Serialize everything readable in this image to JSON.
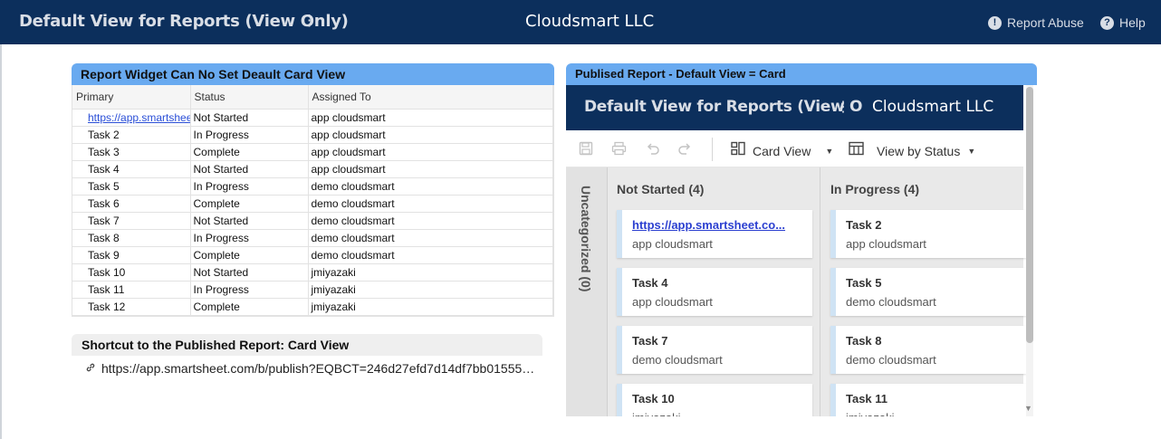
{
  "topbar": {
    "title": "Default View for Reports (View Only)",
    "brand": "Cloudsmart LLC",
    "report_abuse": "Report Abuse",
    "help": "Help"
  },
  "widget_report": {
    "title": "Report Widget Can No Set Deault Card View",
    "columns": [
      "Primary",
      "Status",
      "Assigned To"
    ],
    "rows": [
      [
        "https://app.smartsheet.com",
        "Not Started",
        "app cloudsmart"
      ],
      [
        "Task 2",
        "In Progress",
        "app cloudsmart"
      ],
      [
        "Task 3",
        "Complete",
        "app cloudsmart"
      ],
      [
        "Task 4",
        "Not Started",
        "app cloudsmart"
      ],
      [
        "Task 5",
        "In Progress",
        "demo cloudsmart"
      ],
      [
        "Task 6",
        "Complete",
        "demo cloudsmart"
      ],
      [
        "Task 7",
        "Not Started",
        "demo cloudsmart"
      ],
      [
        "Task 8",
        "In Progress",
        "demo cloudsmart"
      ],
      [
        "Task 9",
        "Complete",
        "demo cloudsmart"
      ],
      [
        "Task 10",
        "Not Started",
        "jmiyazaki"
      ],
      [
        "Task 11",
        "In Progress",
        "jmiyazaki"
      ],
      [
        "Task 12",
        "Complete",
        "jmiyazaki"
      ]
    ]
  },
  "widget_shortcut": {
    "title": "Shortcut to the Published Report: Card View",
    "link_text": "https://app.smartsheet.com/b/publish?EQBCT=246d27efd7d14df7bb01555…"
  },
  "widget_published": {
    "title": "Publised Report - Default View = Card",
    "inner_title": "Default View for Reports (View O",
    "inner_brand": "Cloudsmart LLC",
    "card_view_label": "Card View",
    "view_by_label": "View by Status",
    "uncategorized_label": "Uncategorized (0)",
    "columns": [
      {
        "header": "Not Started (4)",
        "cards": [
          {
            "title": "https://app.smartsheet.co...",
            "sub": "app cloudsmart",
            "link": true
          },
          {
            "title": "Task 4",
            "sub": "app cloudsmart"
          },
          {
            "title": "Task 7",
            "sub": "demo cloudsmart"
          },
          {
            "title": "Task 10",
            "sub": "jmiyazaki"
          }
        ]
      },
      {
        "header": "In Progress (4)",
        "cards": [
          {
            "title": "Task 2",
            "sub": "app cloudsmart"
          },
          {
            "title": "Task 5",
            "sub": "demo cloudsmart"
          },
          {
            "title": "Task 8",
            "sub": "demo cloudsmart"
          },
          {
            "title": "Task 11",
            "sub": "jmiyazaki"
          }
        ]
      }
    ]
  },
  "icons": {
    "topbar_kebab": "⋮",
    "report_abuse": "!",
    "help": "?",
    "link": "🔗",
    "save": "🖫",
    "print": "⎙",
    "undo": "↶",
    "redo": "↷",
    "card_view": "▦",
    "table_view": "▤",
    "caret": "▼",
    "scroll_down": "▼"
  },
  "colors": {
    "topbar_bg": "#0c2f5c",
    "widget_header_blue": "#69aaf0",
    "link": "#2b4fd7"
  }
}
